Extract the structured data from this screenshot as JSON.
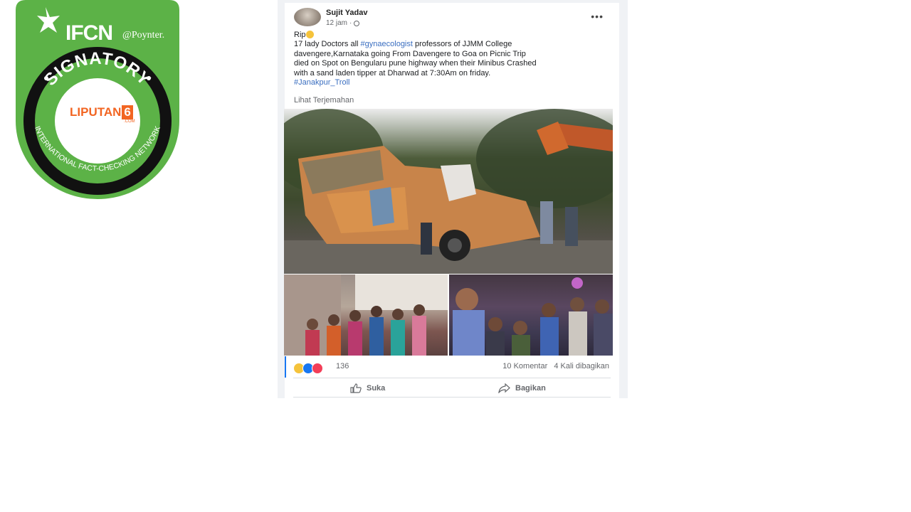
{
  "badge": {
    "org": "IFCN",
    "poynter": "@Poynter.",
    "ring_text": "SIGNATORY",
    "network_text": "INTERNATIONAL FACT-CHECKING NETWORK",
    "logo_text": "LIPUTAN",
    "logo_number": "6",
    "logo_suffix": ".COM",
    "colors": {
      "green": "#5cb247",
      "black": "#111111",
      "orange": "#f26522"
    }
  },
  "post": {
    "author": "Sujit Yadav",
    "time": "12 jam",
    "more": "•••",
    "first_line": "Rip",
    "body_parts": {
      "l1a": "17 lady Doctors all ",
      "l1_tag": "#gynaecologist",
      "l1b": " professors of JJMM College",
      "l2": "davengere,Karnataka going From Davengere to Goa on Picnic Trip",
      "l3": "died on Spot on Bengularu pune highway when their Minibus Crashed",
      "l4": "with a sand laden tipper at Dharwad at 7:30Am on friday.",
      "hashtag": "#Janakpur_Troll"
    },
    "translate": "Lihat Terjemahan",
    "reaction_count": "136",
    "comments": "10 Komentar",
    "shares": "4 Kali dibagikan",
    "actions": {
      "like": "Suka",
      "share": "Bagikan"
    },
    "colors": {
      "link": "#3a6ec0",
      "like": "#1877f2",
      "love": "#f33e58",
      "sad": "#f5c33b"
    }
  }
}
